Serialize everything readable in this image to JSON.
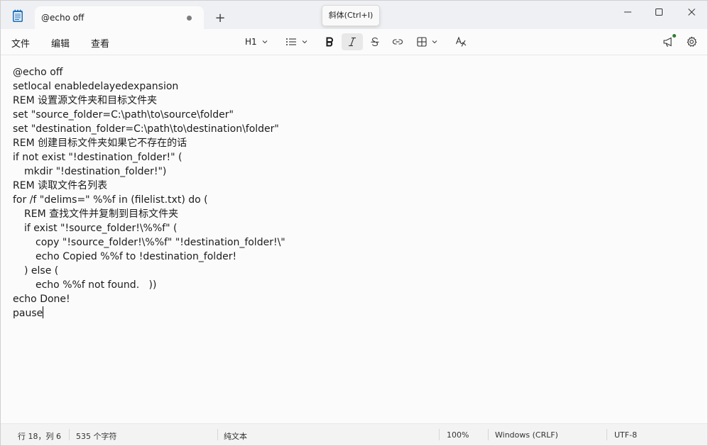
{
  "window": {
    "tab_title": "@echo off",
    "new_tab_label": "+",
    "tooltip": "斜体(Ctrl+I)"
  },
  "menu": {
    "file": "文件",
    "edit": "编辑",
    "view": "查看"
  },
  "toolbar": {
    "heading_label": "H1"
  },
  "editor": {
    "lines": [
      "@echo off",
      "setlocal enabledelayedexpansion",
      "REM 设置源文件夹和目标文件夹",
      "set \"source_folder=C:\\path\\to\\source\\folder\"",
      "set \"destination_folder=C:\\path\\to\\destination\\folder\"",
      "REM 创建目标文件夹如果它不存在的话",
      "if not exist \"!destination_folder!\" (",
      "mkdir \"!destination_folder!\")",
      "REM 读取文件名列表",
      "for /f \"delims=\" %%f in (filelist.txt) do (",
      "REM 查找文件并复制到目标文件夹",
      "if exist \"!source_folder!\\%%f\" (",
      "copy \"!source_folder!\\%%f\" \"!destination_folder!\\\"",
      "echo Copied %%f to !destination_folder!",
      ") else (",
      "echo %%f not found.   ))",
      "echo Done!",
      "pause"
    ]
  },
  "status": {
    "position": "行 18，列 6",
    "char_count": "535 个字符",
    "format": "纯文本",
    "zoom": "100%",
    "line_ending": "Windows (CRLF)",
    "encoding": "UTF-8"
  },
  "icons": {
    "app": "notepad-icon",
    "minimize": "minimize-icon",
    "maximize": "maximize-icon",
    "close": "close-icon",
    "list": "list-icon",
    "bold": "bold-icon",
    "italic": "italic-icon",
    "strikethrough": "strikethrough-icon",
    "link": "link-icon",
    "table": "table-icon",
    "clear_format": "clear-format-icon",
    "announcement": "megaphone-icon",
    "settings": "gear-icon"
  },
  "colors": {
    "notification_dot": "#2e7d32",
    "app_icon": "#1f6fb8"
  }
}
